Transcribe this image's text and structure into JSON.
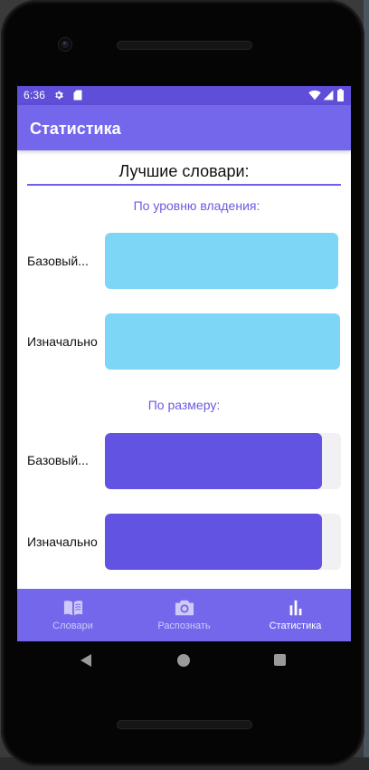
{
  "status_bar": {
    "time": "6:36",
    "icons": [
      "settings-gear-icon",
      "sd-card-icon",
      "wifi-icon",
      "cell-signal-icon",
      "battery-icon"
    ],
    "background": "#5e4ed8"
  },
  "app_bar": {
    "title": "Статистика",
    "background": "#7467ec"
  },
  "content": {
    "title": "Лучшие словари:",
    "sections": [
      {
        "heading": "По уровню владения:",
        "bar_color": "#7dd6f5",
        "rows": [
          {
            "label": "Базовый...",
            "fill_fraction": 1.0
          },
          {
            "label": "Изначально",
            "fill_fraction": 1.0
          }
        ]
      },
      {
        "heading": "По размеру:",
        "bar_color": "#6353e2",
        "rows": [
          {
            "label": "Базовый...",
            "fill_fraction": 0.92
          },
          {
            "label": "Изначально",
            "fill_fraction": 0.92
          }
        ]
      }
    ]
  },
  "bottom_nav": {
    "items": [
      {
        "label": "Словари",
        "icon": "book-icon",
        "active": false
      },
      {
        "label": "Распознать",
        "icon": "camera-icon",
        "active": false
      },
      {
        "label": "Статистика",
        "icon": "bar-chart-icon",
        "active": true
      }
    ]
  },
  "system_nav": {
    "buttons": [
      "back-icon",
      "home-icon",
      "recent-apps-icon"
    ]
  }
}
